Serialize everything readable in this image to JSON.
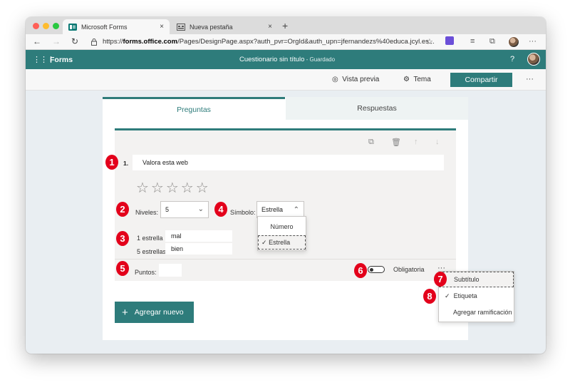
{
  "browser": {
    "tabs": [
      {
        "title": "Microsoft Forms",
        "close": "×"
      },
      {
        "title": "Nueva pestaña",
        "close": "×"
      }
    ],
    "new_tab": "+",
    "url_prefix": "https://",
    "url_host": "forms.office.com",
    "url_rest": "/Pages/DesignPage.aspx?auth_pvr=OrgId&auth_upn=jfernandezs%40educa.jcyl.es...",
    "colors": {
      "close": "#ff5f57",
      "minimize": "#febc2e",
      "zoom": "#28c840"
    }
  },
  "app": {
    "brand": "Forms",
    "title": "Cuestionario sin título",
    "saved": " - Guardado",
    "help": "?",
    "accent": "#2e7c7b"
  },
  "commands": {
    "preview": "Vista previa",
    "theme": "Tema",
    "share": "Compartir",
    "more": "···"
  },
  "panel_tabs": {
    "questions": "Preguntas",
    "responses": "Respuestas"
  },
  "question": {
    "number": "1.",
    "title": "Valora esta web",
    "stars": "☆☆☆☆☆",
    "levels_label": "Niveles:",
    "levels_value": "5",
    "symbol_label": "Símbolo:",
    "symbol_value": "Estrella",
    "low_label": "1 estrella",
    "low_value": "mal",
    "high_label": "5 estrellas",
    "high_value": "bien",
    "points_label": "Puntos:",
    "points_value": "",
    "required_label": "Obligatoria",
    "required_on": false
  },
  "symbol_dropdown": {
    "options": [
      "Número",
      "Estrella"
    ],
    "selected": "Estrella",
    "check": "✓"
  },
  "more_menu": {
    "items": [
      "Subtítulo",
      "Etiqueta",
      "Agregar ramificación"
    ],
    "checked": "Etiqueta",
    "check": "✓"
  },
  "add_new": {
    "label": "Agregar nuevo",
    "plus": "+"
  },
  "badges": [
    "1",
    "2",
    "3",
    "4",
    "5",
    "6",
    "7",
    "8"
  ]
}
